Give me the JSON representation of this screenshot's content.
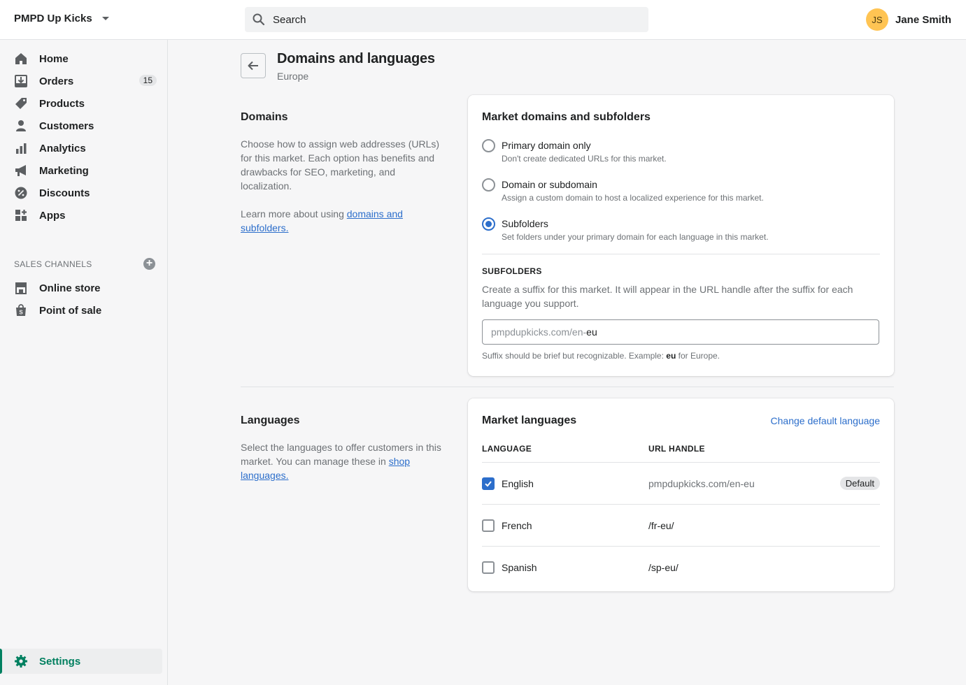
{
  "topbar": {
    "store_name": "PMPD Up Kicks",
    "search_placeholder": "Search",
    "user_initials": "JS",
    "user_name": "Jane Smith",
    "avatar_color": "#ffc453"
  },
  "sidebar": {
    "items": [
      {
        "label": "Home",
        "icon": "home-icon"
      },
      {
        "label": "Orders",
        "icon": "orders-icon",
        "badge": "15"
      },
      {
        "label": "Products",
        "icon": "tag-icon"
      },
      {
        "label": "Customers",
        "icon": "person-icon"
      },
      {
        "label": "Analytics",
        "icon": "bar-chart-icon"
      },
      {
        "label": "Marketing",
        "icon": "megaphone-icon"
      },
      {
        "label": "Discounts",
        "icon": "discount-icon"
      },
      {
        "label": "Apps",
        "icon": "apps-icon"
      }
    ],
    "sales_channels_title": "SALES CHANNELS",
    "channels": [
      {
        "label": "Online store",
        "icon": "store-icon"
      },
      {
        "label": "Point of sale",
        "icon": "shopping-bag-icon"
      }
    ],
    "settings_label": "Settings",
    "accent_color": "#008060"
  },
  "page": {
    "title": "Domains and languages",
    "subtitle": "Europe"
  },
  "domains_section": {
    "title": "Domains",
    "description": "Choose how to assign web addresses (URLs) for this market. Each option has benefits and drawbacks for SEO, marketing, and localization.",
    "learn_prefix": "Learn more about using ",
    "learn_link": "domains and subfolders."
  },
  "domains_card": {
    "title": "Market domains and subfolders",
    "options": [
      {
        "label": "Primary domain only",
        "help": "Don't create dedicated URLs for this market.",
        "selected": false
      },
      {
        "label": "Domain or subdomain",
        "help": "Assign a custom domain to host a localized experience for this market.",
        "selected": false
      },
      {
        "label": "Subfolders",
        "help": "Set folders under your primary domain for each language in this market.",
        "selected": true
      }
    ],
    "subfolders_heading": "SUBFOLDERS",
    "subfolders_desc": "Create a suffix for this market. It will appear in the URL handle after the suffix for each language you support.",
    "input_prefix": "pmpdupkicks.com/en-",
    "input_value": "eu",
    "hint_prefix": "Suffix should be brief but recognizable. Example: ",
    "hint_bold": "eu",
    "hint_suffix": " for Europe."
  },
  "languages_section": {
    "title": "Languages",
    "description": "Select the languages to offer customers in this market. You can manage these in ",
    "link": "shop languages."
  },
  "languages_card": {
    "title": "Market languages",
    "change_link": "Change default language",
    "col_language": "LANGUAGE",
    "col_handle": "URL HANDLE",
    "rows": [
      {
        "language": "English",
        "handle": "pmpdupkicks.com/en-eu",
        "checked": true,
        "badge": "Default"
      },
      {
        "language": "French",
        "handle": "/fr-eu/",
        "checked": false
      },
      {
        "language": "Spanish",
        "handle": "/sp-eu/",
        "checked": false
      }
    ]
  },
  "colors": {
    "link": "#2c6ecb",
    "selected": "#2c6ecb"
  }
}
